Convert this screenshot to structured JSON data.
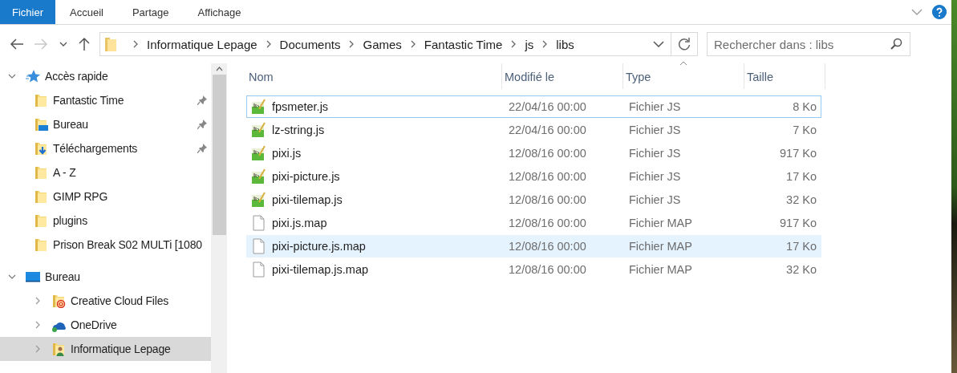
{
  "ribbon": {
    "tabs": [
      {
        "label": "Fichier",
        "selected": true
      },
      {
        "label": "Accueil",
        "selected": false
      },
      {
        "label": "Partage",
        "selected": false
      },
      {
        "label": "Affichage",
        "selected": false
      }
    ]
  },
  "address_bar": {
    "path": [
      "Informatique Lepage",
      "Documents",
      "Games",
      "Fantastic Time",
      "js",
      "libs"
    ]
  },
  "search": {
    "placeholder": "Rechercher dans : libs"
  },
  "navigation": [
    {
      "label": "Accès rapide",
      "kind": "star",
      "expanded": true,
      "selected": false,
      "children": [
        {
          "label": "Fantastic Time",
          "kind": "folder",
          "pinned": true,
          "selected": false
        },
        {
          "label": "Bureau",
          "kind": "desktop-folder",
          "pinned": true,
          "selected": false
        },
        {
          "label": "Téléchargements",
          "kind": "download-folder",
          "pinned": true,
          "selected": false
        },
        {
          "label": "A - Z",
          "kind": "folder",
          "pinned": false,
          "selected": false
        },
        {
          "label": "GIMP RPG",
          "kind": "folder",
          "pinned": false,
          "selected": false
        },
        {
          "label": "plugins",
          "kind": "folder",
          "pinned": false,
          "selected": false
        },
        {
          "label": "Prison Break S02 MULTi [1080",
          "kind": "folder",
          "pinned": false,
          "selected": false
        }
      ]
    },
    {
      "label": "Bureau",
      "kind": "desktop",
      "expanded": true,
      "selected": false,
      "children": [
        {
          "label": "Creative Cloud Files",
          "kind": "cc-folder",
          "expanded": false,
          "selected": false
        },
        {
          "label": "OneDrive",
          "kind": "cloud",
          "expanded": false,
          "selected": false
        },
        {
          "label": "Informatique Lepage",
          "kind": "user-folder",
          "expanded": false,
          "selected": true
        }
      ]
    }
  ],
  "table": {
    "columns": [
      "Nom",
      "Modifié le",
      "Type",
      "Taille"
    ],
    "rows": [
      {
        "name": "fpsmeter.js",
        "modified": "22/04/16 00:00",
        "type": "Fichier JS",
        "size": "8 Ko",
        "kind": "js",
        "focused": true,
        "hovered": false
      },
      {
        "name": "lz-string.js",
        "modified": "22/04/16 00:00",
        "type": "Fichier JS",
        "size": "7 Ko",
        "kind": "js",
        "focused": false,
        "hovered": false
      },
      {
        "name": "pixi.js",
        "modified": "12/08/16 00:00",
        "type": "Fichier JS",
        "size": "917 Ko",
        "kind": "js",
        "focused": false,
        "hovered": false
      },
      {
        "name": "pixi-picture.js",
        "modified": "12/08/16 00:00",
        "type": "Fichier JS",
        "size": "17 Ko",
        "kind": "js",
        "focused": false,
        "hovered": false
      },
      {
        "name": "pixi-tilemap.js",
        "modified": "12/08/16 00:00",
        "type": "Fichier JS",
        "size": "32 Ko",
        "kind": "js",
        "focused": false,
        "hovered": false
      },
      {
        "name": "pixi.js.map",
        "modified": "12/08/16 00:00",
        "type": "Fichier MAP",
        "size": "917 Ko",
        "kind": "map",
        "focused": false,
        "hovered": false
      },
      {
        "name": "pixi-picture.js.map",
        "modified": "12/08/16 00:00",
        "type": "Fichier MAP",
        "size": "17 Ko",
        "kind": "map",
        "focused": false,
        "hovered": true
      },
      {
        "name": "pixi-tilemap.js.map",
        "modified": "12/08/16 00:00",
        "type": "Fichier MAP",
        "size": "32 Ko",
        "kind": "map",
        "focused": false,
        "hovered": false
      }
    ]
  }
}
